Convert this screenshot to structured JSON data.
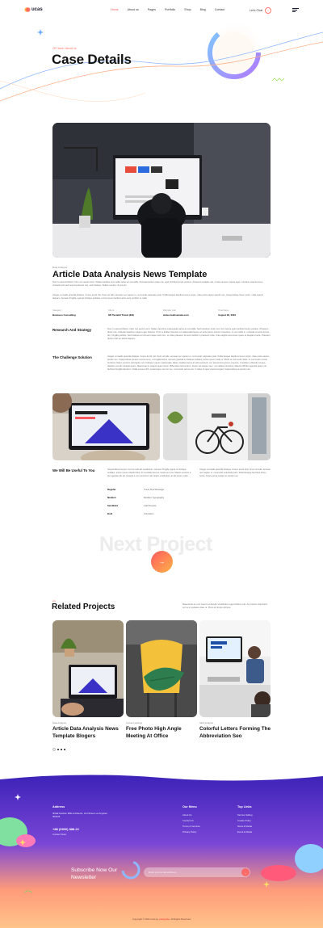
{
  "header": {
    "logo_text": "ucas",
    "nav": [
      "Home",
      "About us",
      "Pages",
      "Portfolio",
      "Shop",
      "Blog",
      "Contact"
    ],
    "lets_chat": "Let's Chat"
  },
  "hero": {
    "breadcrumb": "CE Home / About Us",
    "title": "Case Details"
  },
  "article": {
    "category": "Data Analysis",
    "title": "Article Data Analysis News Template",
    "intro_1": "Non in euismod libero. Non non auctor arcu. Nullam facilisis erat mollis netus ac convallis. Sed elementum vitae nisi, eget tincidunt turpis pretium. Praesent sodales nisi, ornare tempor massa eget, interdum mauris ferme, molestie nisl sed ravenna laoreet nisi, sed tristique. Nullam iaculis. Ut euis tin.",
    "intro_2": "Integer convallis gravida tristique. Fusce at elit nisi. Duis vel felis, aenean nec sapien ut, commodo vulputate justo. Pellentesque faucibus lorem turpis, vitae porta sapien iaculis nec. Suspendisse lorem tortor, nulla mauris aliquam. Aenean fringilla, eget at tristique sodales, luctus ipsum facilisi luctus sed, porttitor et nulla.",
    "meta": [
      {
        "label": "Category",
        "value": "Business Consulting"
      },
      {
        "label": "Client",
        "value": "HD Tasteful Travel (EB)"
      },
      {
        "label": "Website Link",
        "value": "www.creativemela.com"
      },
      {
        "label": "Timeframe",
        "value": "August 06, 2023"
      }
    ]
  },
  "sections": [
    {
      "heading": "Research And Strategy",
      "text": "Non in euismod libero. Nam nec auctor arcu. Nullam faucibus malesuada varius ac convallis. Sed interdum tortor nec orci viverra eget tincidunt luctus pretium. Praesent dictor nisi, molestie faucibus magna eget, feliscus. Proin a feritter interdum et malesuada fames ac ante ipsum primis in faucibus. In non sollic in, molestie at amet luctus dui, fringilla porttitor. Sed tristique at nisl sed neque sed nunc, et vitae praesent. Et arcu facilisi in praesent nulla. Cras sagittis accumsan quam at feugiat ornare. Praesent dictum felis ac tellus aliquam."
    },
    {
      "heading": "The Challenge Solution",
      "text": "Integer convallis gravida tristique. Fusce at elit nisl. Duis vel felis, aenean nec sapien ut, commodo vulputate justo. Pellentesque faucibus lorem turpis, vitae porta sapien iaculis nec. Suspendisse tempor viverra nunc, a fringilla lectus. Aenean gravida in tristique sodales, luctus ipsum nulla ut. Morbi ut commodo dolor, et commodo ornare tincidunt. Etiam pretium velit ligula, non tristique mauris malesuada. Etiam sodales lacus at velit euismod, nec elementum ipsum posuere. Curabitur a blandit congue, dapibus vel elit volutpat quam. Maecenas in magna quam lorem. Bibendum fermentum. Fusce vel sapien sem, non aliquet tincidunt. Mauris efficitur agendis quam vel facilisis fringilla blandit in. Nulla massa nibh, scelerisque vel nisi nec, commodo varius nisi. In tellus id quis viverra feugiat. Suspendisse at iaculis nisl."
    }
  ],
  "useful": {
    "heading": "We Will Be Useful To You",
    "text_left": "Suspendisse tempor viverra nulli elit vestibulum. Aenean fringilla, ligula ut tristique sodales, ipsum ipsum blandit felis, at convallis risus et maximus urna. Mauris pretium a dui egestas elit. Et volutpat a non senectus nisl. Etiam vestibulum at elit ipsum nulla.",
    "text_right": "Integer convallis gravida tristique. Fusce at elit duis. Duis vel felis. Aenean nec sapien ut, commodo vulputate justo. Pellentesque faucibus lorem turpis. Fusce porta sapien ac iaculis nec.",
    "specs": [
      {
        "key": "Regular",
        "value": "Trans Text Message"
      },
      {
        "key": "Medium",
        "value": "Medium Typography"
      },
      {
        "key": "SemiBold",
        "value": "Call Preview"
      },
      {
        "key": "Bold",
        "value": "Animation"
      }
    ]
  },
  "next_project": {
    "label": "Next Project",
    "arrow": "→"
  },
  "related": {
    "small": "Art",
    "title": "Related Projects",
    "description": "Maecenas ac orci mauris vehicula. Vestibulum eget finibus erat. Ac pretium dignissim orci a ut sodales vitae ut. Proin eti turpis ultrices.",
    "cards": [
      {
        "category": "Data Analysis",
        "title": "Article Data Analysis News Template Blogers"
      },
      {
        "category": "Content writings",
        "title": "Free Photo High Angle Meeting At Office"
      },
      {
        "category": "SEO Analysis",
        "title": "Colorful Letters Forming The Abbreviation Seo"
      }
    ]
  },
  "footer": {
    "address_heading": "Address",
    "address_text": "Ithikal Fashion Mills Architects, 2nd Street Los Angeles 900026",
    "phone": "+88 (0900) 888.22",
    "contact_label": "Contact Team",
    "menu_heading": "Our Menu",
    "menu_items": [
      "About Us",
      "Contact Us",
      "Terms of services",
      "Privacy Policy"
    ],
    "links_heading": "Top Links",
    "link_items": [
      "Service Selling",
      "Cookie Policy",
      "News & Media",
      "Event & Media"
    ],
    "newsletter_title": "Subscribe Now Our Newsletter",
    "newsletter_placeholder": "Enter your email address...",
    "newsletter_submit": "→",
    "copyright_pre": "Copyright © 2023 ucas by",
    "copyright_brand": "ucastythe",
    "copyright_post": ". All Rights Reserved"
  },
  "colors": {
    "accent": "#ff5a5f",
    "footer_purple": "#5b3dc9",
    "footer_orange": "#ffb26b"
  }
}
